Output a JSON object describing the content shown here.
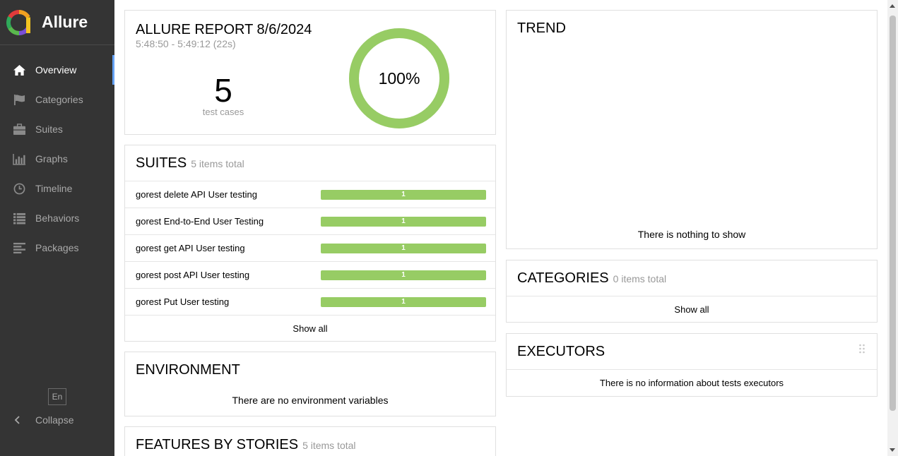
{
  "app": {
    "name": "Allure"
  },
  "sidebar": {
    "items": [
      {
        "label": "Overview",
        "icon": "home-icon",
        "active": true
      },
      {
        "label": "Categories",
        "icon": "flag-icon",
        "active": false
      },
      {
        "label": "Suites",
        "icon": "briefcase-icon",
        "active": false
      },
      {
        "label": "Graphs",
        "icon": "bar-chart-icon",
        "active": false
      },
      {
        "label": "Timeline",
        "icon": "clock-icon",
        "active": false
      },
      {
        "label": "Behaviors",
        "icon": "list-icon",
        "active": false
      },
      {
        "label": "Packages",
        "icon": "align-left-icon",
        "active": false
      }
    ],
    "language": "En",
    "collapse_label": "Collapse"
  },
  "summary": {
    "title": "ALLURE REPORT 8/6/2024",
    "time_range": "5:48:50 - 5:49:12 (22s)",
    "test_count": "5",
    "test_count_label": "test cases",
    "success_rate": "100%",
    "pass_fraction": 1.0,
    "pass_color": "#97cc64"
  },
  "suites": {
    "title": "SUITES",
    "subtitle": "5 items total",
    "rows": [
      {
        "name": "gorest delete API User testing",
        "passed": "1"
      },
      {
        "name": "gorest End-to-End User Testing",
        "passed": "1"
      },
      {
        "name": "gorest get API User testing",
        "passed": "1"
      },
      {
        "name": "gorest post API User testing",
        "passed": "1"
      },
      {
        "name": "gorest Put User testing",
        "passed": "1"
      }
    ],
    "show_all": "Show all"
  },
  "environment": {
    "title": "ENVIRONMENT",
    "empty": "There are no environment variables"
  },
  "features": {
    "title": "FEATURES BY STORIES",
    "subtitle": "5 items total"
  },
  "trend": {
    "title": "TREND",
    "empty": "There is nothing to show"
  },
  "categories": {
    "title": "CATEGORIES",
    "subtitle": "0 items total",
    "show_all": "Show all"
  },
  "executors": {
    "title": "EXECUTORS",
    "empty": "There is no information about tests executors"
  }
}
